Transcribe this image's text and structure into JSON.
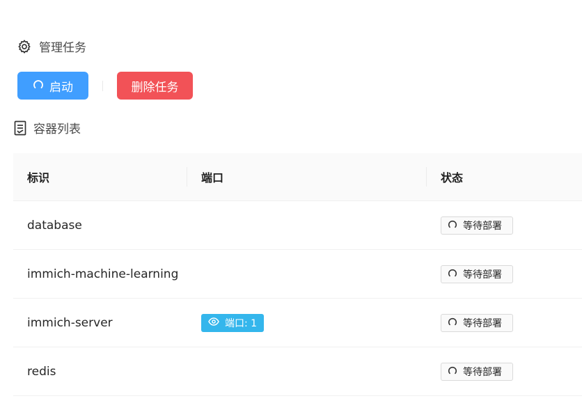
{
  "manage": {
    "title": "管理任务"
  },
  "actions": {
    "start_label": "启动",
    "delete_label": "删除任务"
  },
  "containers": {
    "title": "容器列表",
    "columns": [
      "标识",
      "端口",
      "状态"
    ],
    "rows": [
      {
        "id": "database",
        "port": "",
        "status": "等待部署"
      },
      {
        "id": "immich-machine-learning",
        "port": "",
        "status": "等待部署"
      },
      {
        "id": "immich-server",
        "port": "端口: 1",
        "status": "等待部署"
      },
      {
        "id": "redis",
        "port": "",
        "status": "等待部署"
      }
    ]
  },
  "colors": {
    "primary": "#409eff",
    "danger": "#f25257",
    "info": "#34b6ec"
  },
  "icons": {
    "manage": "gear-icon",
    "containers": "document-list-icon",
    "start": "loading-icon",
    "port": "eye-icon",
    "status": "loading-icon"
  }
}
